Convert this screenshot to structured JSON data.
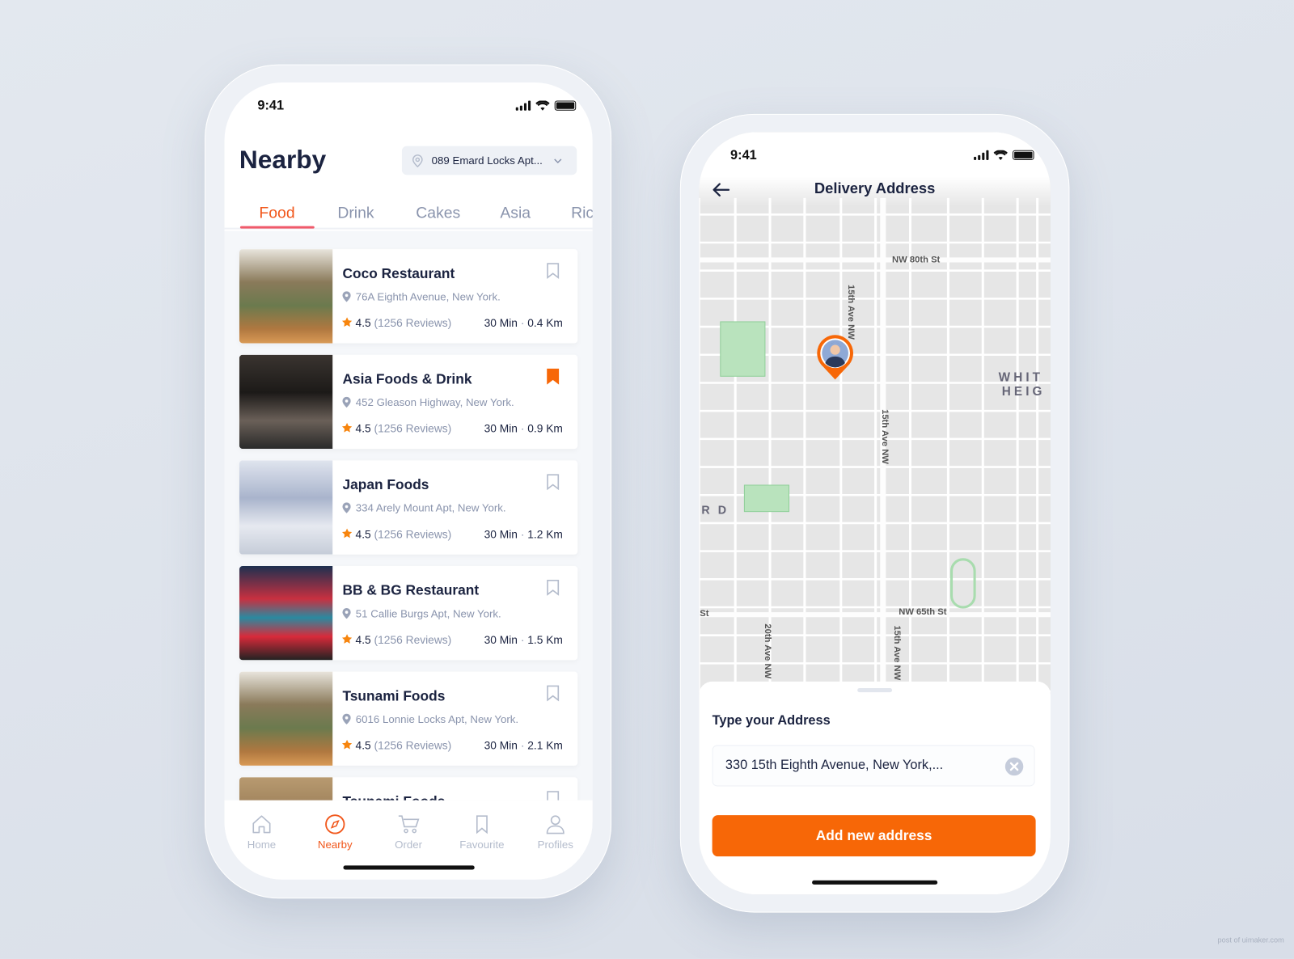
{
  "nearby_screen": {
    "status_time": "9:41",
    "title": "Nearby",
    "location_selector": "089 Emard Locks Apt...",
    "tabs": [
      {
        "label": "Food",
        "active": true
      },
      {
        "label": "Drink"
      },
      {
        "label": "Cakes"
      },
      {
        "label": "Asia"
      },
      {
        "label": "Ric"
      }
    ],
    "restaurants": [
      {
        "name": "Coco Restaurant",
        "address": "76A Eighth Avenue, New York.",
        "rating": "4.5",
        "reviews": "(1256 Reviews)",
        "time": "30 Min",
        "distance": "0.4 Km",
        "bookmarked": false
      },
      {
        "name": "Asia Foods & Drink",
        "address": "452 Gleason Highway, New York.",
        "rating": "4.5",
        "reviews": "(1256 Reviews)",
        "time": "30 Min",
        "distance": "0.9 Km",
        "bookmarked": true
      },
      {
        "name": "Japan Foods",
        "address": "334 Arely Mount Apt, New York.",
        "rating": "4.5",
        "reviews": "(1256 Reviews)",
        "time": "30 Min",
        "distance": "1.2 Km",
        "bookmarked": false
      },
      {
        "name": "BB & BG Restaurant",
        "address": "51 Callie Burgs Apt, New York.",
        "rating": "4.5",
        "reviews": "(1256 Reviews)",
        "time": "30 Min",
        "distance": "1.5 Km",
        "bookmarked": false
      },
      {
        "name": "Tsunami Foods",
        "address": "6016 Lonnie Locks Apt, New York.",
        "rating": "4.5",
        "reviews": "(1256 Reviews)",
        "time": "30 Min",
        "distance": "2.1 Km",
        "bookmarked": false
      },
      {
        "name": "Tsunami Foods",
        "bookmarked": false
      }
    ],
    "bottom_nav": [
      {
        "label": "Home",
        "icon": "home-icon"
      },
      {
        "label": "Nearby",
        "icon": "compass-icon",
        "active": true
      },
      {
        "label": "Order",
        "icon": "cart-icon"
      },
      {
        "label": "Favourite",
        "icon": "bookmark-icon"
      },
      {
        "label": "Profiles",
        "icon": "user-icon"
      }
    ]
  },
  "address_screen": {
    "status_time": "9:41",
    "title": "Delivery Address",
    "map_labels": {
      "nw80": "NW 80th St",
      "ave15a": "15th Ave NW",
      "ave15b": "15th Ave NW",
      "ave15c": "15th Ave NW",
      "ave20": "20th Ave NW",
      "nw65": "NW 65th St",
      "st": "St",
      "rd": "R D",
      "whit": "WHIT",
      "heig": "HEIG"
    },
    "address_label": "Type your Address",
    "address_value": "330 15th Eighth Avenue, New York,...",
    "add_button": "Add new address"
  },
  "colors": {
    "accent": "#f76707",
    "tab_active": "#f1571b",
    "text_dark": "#1b2340",
    "text_muted": "#8a94ad"
  },
  "watermark": "post of uimaker.com"
}
